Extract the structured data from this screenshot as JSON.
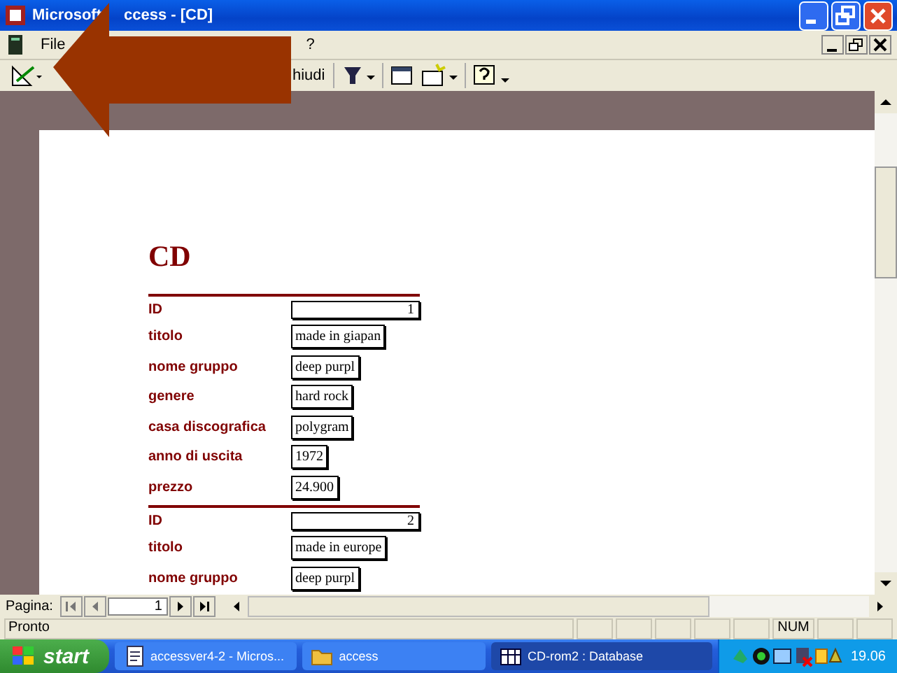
{
  "window": {
    "title_parts": [
      "Microsoft",
      "ccess - [CD]"
    ]
  },
  "menu": [
    {
      "label": "File"
    },
    {
      "label": "?"
    }
  ],
  "toolbar": {
    "close_label": "hiudi"
  },
  "report": {
    "title": "CD",
    "records": [
      {
        "fields": [
          {
            "kind": "id",
            "label": "ID",
            "value": "1"
          },
          {
            "kind": "text",
            "label": "titolo",
            "value": "made in giapan"
          },
          {
            "kind": "text",
            "label": "nome gruppo",
            "value": "deep purpl"
          },
          {
            "kind": "text",
            "label": "genere",
            "value": "hard rock"
          },
          {
            "kind": "text",
            "label": "casa discografica",
            "value": "polygram"
          },
          {
            "kind": "text",
            "label": "anno di uscita",
            "value": "1972"
          },
          {
            "kind": "text",
            "label": "prezzo",
            "value": "24.900"
          }
        ]
      },
      {
        "fields": [
          {
            "kind": "id",
            "label": "ID",
            "value": "2"
          },
          {
            "kind": "text",
            "label": "titolo",
            "value": "made in europe"
          },
          {
            "kind": "text",
            "label": "nome gruppo",
            "value": "deep purpl"
          }
        ]
      }
    ]
  },
  "navigation": {
    "label": "Pagina:",
    "page": "1"
  },
  "status_bar": {
    "text": "Pronto",
    "indicators": [
      "NUM"
    ]
  },
  "taskbar": {
    "start": "start",
    "tasks": [
      {
        "label": "accessver4-2 - Micros...",
        "kind": "doc",
        "selected": false
      },
      {
        "label": "access",
        "kind": "folder",
        "selected": false
      },
      {
        "label": "CD-rom2 : Database",
        "kind": "db",
        "selected": true
      }
    ],
    "clock": "19.06"
  }
}
